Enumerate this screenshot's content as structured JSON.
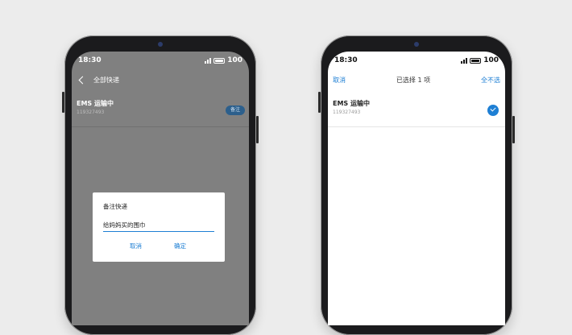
{
  "left_phone": {
    "status": {
      "time": "18:30",
      "signal": "4G",
      "battery": "100"
    },
    "nav": {
      "title": "全部快递"
    },
    "item": {
      "title": "EMS 运输中",
      "number": "119327493",
      "note_button": "备注"
    },
    "dialog": {
      "title": "备注快递",
      "input_value": "给妈妈买的围巾",
      "cancel": "取消",
      "ok": "确定"
    }
  },
  "right_phone": {
    "status": {
      "time": "18:30",
      "signal": "4G",
      "battery": "100"
    },
    "nav": {
      "cancel": "取消",
      "title": "已选择 1 项",
      "select_none": "全不选"
    },
    "item": {
      "title": "EMS 运输中",
      "number": "119327493",
      "checked": true
    }
  },
  "colors": {
    "accent": "#1e7fd4",
    "overlay": "#808080"
  }
}
